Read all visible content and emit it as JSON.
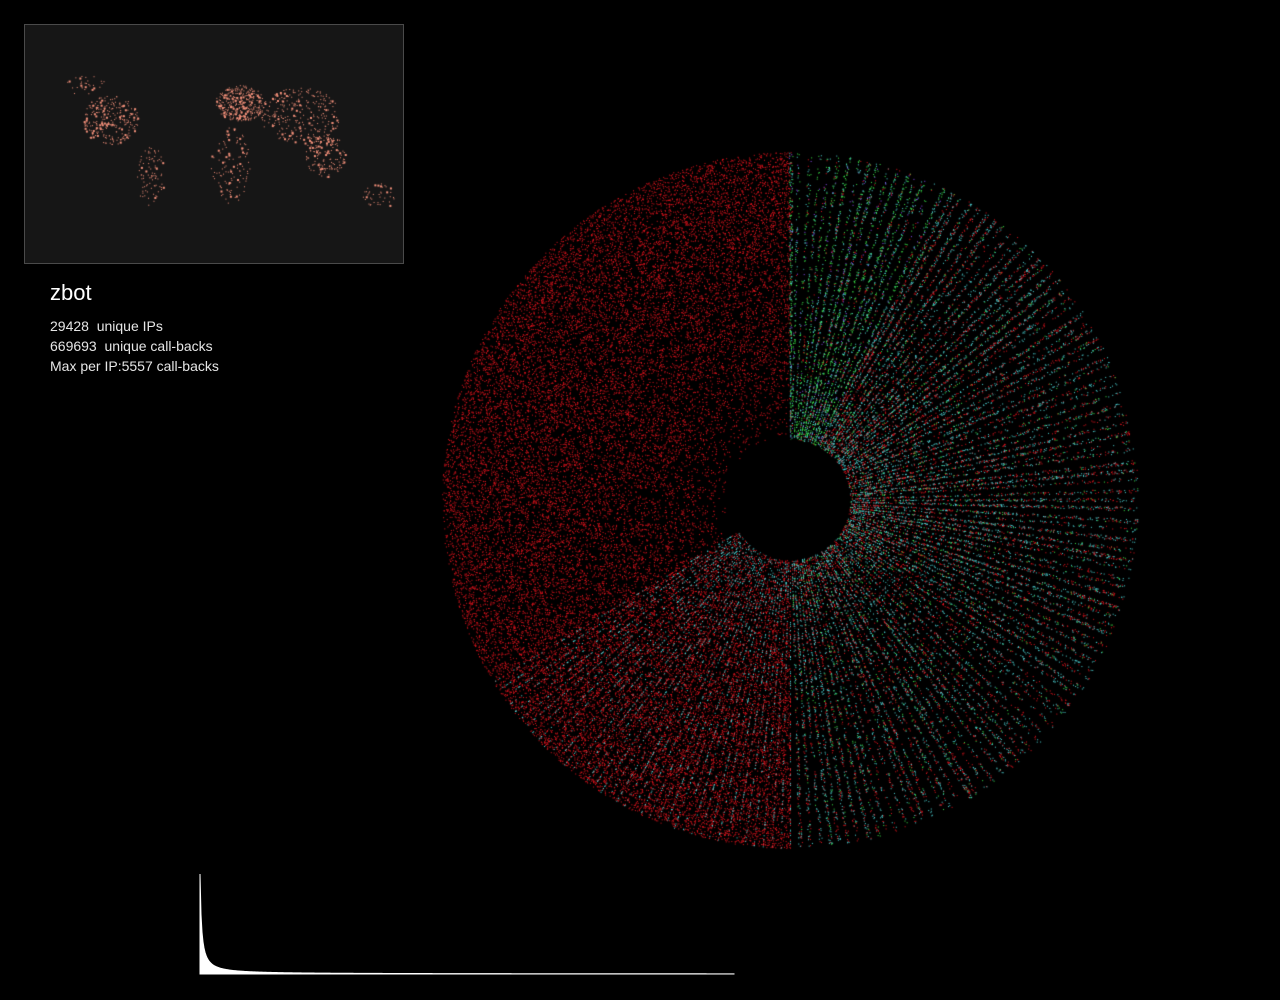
{
  "title": "zbot",
  "stats": {
    "unique_ips": "29428  unique IPs",
    "unique_callbacks": "669693  unique call-backs",
    "max_per_ip": "Max per IP:5557 call-backs"
  },
  "colors": {
    "background": "#000000",
    "map_background": "#161616",
    "map_border": "#4a4a4a",
    "map_dots": "#f3907a",
    "radial_red": "#e0141e",
    "radial_cyan": "#4ed6d8",
    "radial_green": "#3ce84a",
    "radial_purple": "#8a4cf0",
    "histogram": "#ffffff"
  },
  "icons": {
    "map": "world-map-icon",
    "radial": "radial-scatter-icon",
    "histogram": "histogram-icon"
  }
}
